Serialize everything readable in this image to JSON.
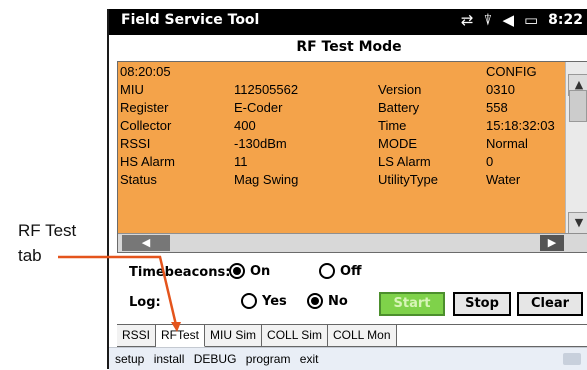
{
  "callout": {
    "line1": "RF Test",
    "line2": "tab"
  },
  "titlebar": {
    "app_title": "Field Service Tool",
    "time": "8:22",
    "icons": [
      "connectivity-icon",
      "signal-off-icon",
      "volume-icon",
      "battery-icon"
    ]
  },
  "screen_title": "RF Test Mode",
  "grid": {
    "rows": [
      {
        "col1": "08:20:05",
        "col2": "",
        "col3": "",
        "col4": "CONFIG"
      },
      {
        "col1": "MIU",
        "col2": "112505562",
        "col3": "Version",
        "col4": "0310"
      },
      {
        "col1": "Register",
        "col2": "E-Coder",
        "col3": "Battery",
        "col4": "558"
      },
      {
        "col1": "Collector",
        "col2": "400",
        "col3": "Time",
        "col4": "15:18:32:03"
      },
      {
        "col1": "RSSI",
        "col2": "-130dBm",
        "col3": "MODE",
        "col4": "Normal"
      },
      {
        "col1": "HS Alarm",
        "col2": "11",
        "col3": "LS Alarm",
        "col4": "0"
      },
      {
        "col1": "Status",
        "col2": "Mag Swing",
        "col3": "UtilityType",
        "col4": "Water"
      }
    ],
    "highlight_color": "#f4a34a"
  },
  "controls": {
    "timebeacons_label": "Timebeacons:",
    "timebeacons_on": "On",
    "timebeacons_off": "Off",
    "log_label": "Log:",
    "log_yes": "Yes",
    "log_no": "No",
    "start": "Start",
    "stop": "Stop",
    "clear": "Clear"
  },
  "tabs": [
    "RSSI",
    "RFTest",
    "MIU Sim",
    "COLL Sim",
    "COLL Mon"
  ],
  "active_tab": "RFTest",
  "menu": [
    "setup",
    "install",
    "DEBUG",
    "program",
    "exit"
  ]
}
